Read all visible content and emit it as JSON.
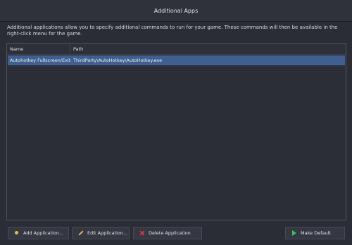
{
  "window": {
    "title": "Additional Apps"
  },
  "description": "Additional applications allow you to specify additional commands to run for your game.  These commands will then be available in the right-click menu for the game.",
  "table": {
    "columns": [
      "Name",
      "Path"
    ],
    "rows": [
      {
        "name": "Autohotkey Fullscreen/Exit",
        "path": "ThirdParty\\AutoHotkey\\AutoHotkey.exe",
        "selected": true
      }
    ]
  },
  "buttons": {
    "add": {
      "label": "Add Application...",
      "icon": "plus-icon"
    },
    "edit": {
      "label": "Edit Application...",
      "icon": "pencil-icon"
    },
    "delete": {
      "label": "Delete Application",
      "icon": "delete-icon"
    },
    "default": {
      "label": "Make Default",
      "icon": "flag-icon"
    }
  },
  "colors": {
    "background": "#2a2c36",
    "selected_row": "#3e5f8f",
    "delete_accent": "#d23a3a",
    "default_accent": "#3cc156",
    "add_accent": "#e2c53c"
  }
}
